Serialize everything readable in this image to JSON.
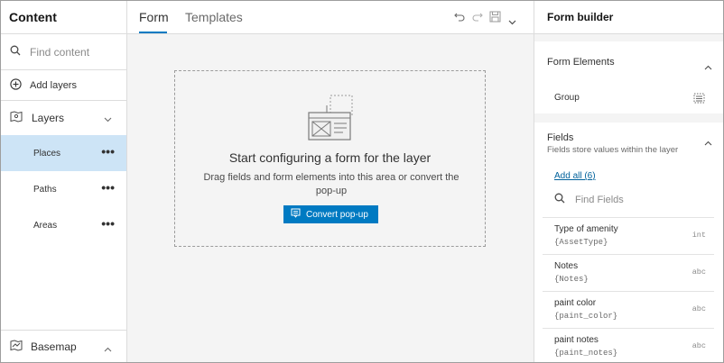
{
  "left_panel": {
    "title": "Content",
    "search_placeholder": "Find content",
    "add_layers": "Add layers",
    "layers_label": "Layers",
    "layers": [
      {
        "label": "Places",
        "selected": true
      },
      {
        "label": "Paths",
        "selected": false
      },
      {
        "label": "Areas",
        "selected": false
      }
    ],
    "basemap_label": "Basemap"
  },
  "center": {
    "tabs": [
      {
        "label": "Form",
        "active": true
      },
      {
        "label": "Templates",
        "active": false
      }
    ],
    "toolbar_icons": [
      "undo-icon",
      "redo-icon",
      "save-icon",
      "chevron-down-icon"
    ],
    "dropzone": {
      "title": "Start configuring a form for the layer",
      "subtitle": "Drag fields and form elements into this area or convert the pop-up",
      "button": "Convert pop-up"
    }
  },
  "right_panel": {
    "title": "Form builder",
    "form_elements": {
      "label": "Form Elements",
      "items": [
        {
          "label": "Group",
          "icon": "group-icon"
        }
      ]
    },
    "fields": {
      "label": "Fields",
      "description": "Fields store values within the layer",
      "add_all": "Add all (6)",
      "search_placeholder": "Find Fields",
      "items": [
        {
          "name": "Type of amenity",
          "expression": "{AssetType}",
          "type": "int"
        },
        {
          "name": "Notes",
          "expression": "{Notes}",
          "type": "abc"
        },
        {
          "name": "paint color",
          "expression": "{paint_color}",
          "type": "abc"
        },
        {
          "name": "paint notes",
          "expression": "{paint_notes}",
          "type": "abc"
        }
      ]
    }
  },
  "colors": {
    "accent": "#007ac2",
    "selected_row": "#cde4f6",
    "canvas_bg": "#f4f4f4",
    "link": "#00619b"
  }
}
